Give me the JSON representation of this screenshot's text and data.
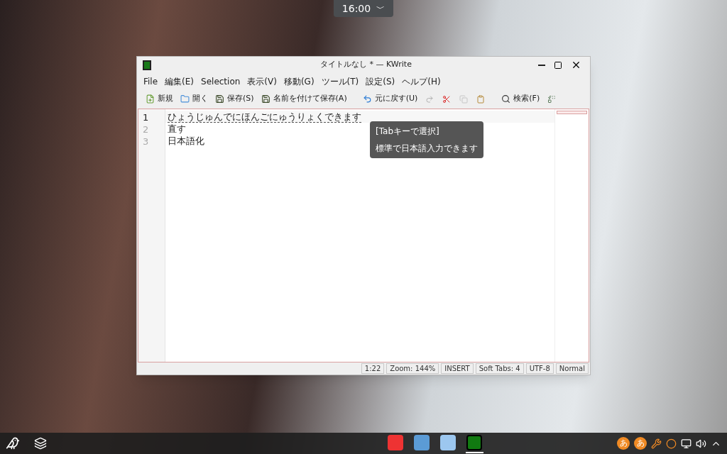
{
  "clock": {
    "time": "16:00",
    "caret": "﹀"
  },
  "window": {
    "title": "タイトルなし * — KWrite"
  },
  "menu": [
    "File",
    "編集(E)",
    "Selection",
    "表示(V)",
    "移動(G)",
    "ツール(T)",
    "設定(S)",
    "ヘルプ(H)"
  ],
  "toolbar": [
    {
      "kind": "labeled",
      "label": "新規",
      "disabled": false
    },
    {
      "kind": "labeled",
      "label": "開く",
      "disabled": false
    },
    {
      "kind": "labeled",
      "label": "保存(S)",
      "disabled": false
    },
    {
      "kind": "labeled",
      "label": "名前を付けて保存(A)",
      "disabled": false
    },
    {
      "kind": "labeled",
      "label": "元に戻す(U)",
      "disabled": false
    },
    {
      "kind": "icon",
      "disabled": true
    },
    {
      "kind": "icon",
      "disabled": false
    },
    {
      "kind": "icon",
      "disabled": true
    },
    {
      "kind": "icon",
      "disabled": false
    },
    {
      "kind": "labeled",
      "label": "検索(F)",
      "disabled": false
    },
    {
      "kind": "icon",
      "disabled": false
    }
  ],
  "editor": {
    "lines": [
      {
        "number": "1",
        "text": "ひょうじゅんでにほんごにゅうりょくできます",
        "current": true,
        "composing": true
      },
      {
        "number": "2",
        "text": "直す",
        "current": false,
        "composing": false
      },
      {
        "number": "3",
        "text": "日本語化",
        "current": false,
        "composing": false
      }
    ]
  },
  "tooltip": {
    "title": "[Tabキーで選択]",
    "text": "標準で日本語入力できます"
  },
  "status_bar": [
    "1:22",
    "Zoom: 144%",
    "INSERT",
    "Soft Tabs: 4",
    "UTF-8",
    "Normal"
  ],
  "taskbar": {
    "apps": [
      {
        "selected": false
      },
      {
        "selected": false
      },
      {
        "selected": false
      },
      {
        "selected": true
      }
    ],
    "tray": [
      {
        "kind": "text",
        "label": "あ"
      },
      {
        "kind": "text",
        "label": "あ"
      },
      {
        "kind": "icon"
      },
      {
        "kind": "icon"
      },
      {
        "kind": "icon"
      },
      {
        "kind": "icon"
      },
      {
        "kind": "icon"
      }
    ]
  }
}
